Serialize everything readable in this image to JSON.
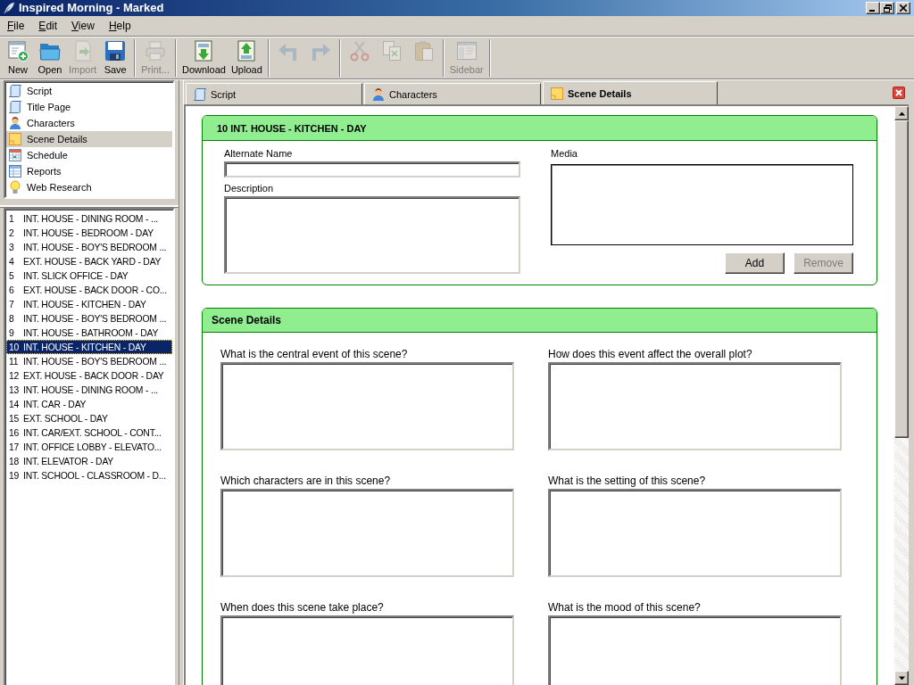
{
  "window": {
    "title": "Inspired Morning - Marked"
  },
  "menu": [
    "File",
    "Edit",
    "View",
    "Help"
  ],
  "toolbar": {
    "groups": [
      [
        {
          "label": "New",
          "disabled": false
        },
        {
          "label": "Open",
          "disabled": false
        },
        {
          "label": "Import",
          "disabled": true
        },
        {
          "label": "Save",
          "disabled": false
        }
      ],
      [
        {
          "label": "Print...",
          "disabled": true
        }
      ],
      [
        {
          "label": "Download",
          "disabled": false
        },
        {
          "label": "Upload",
          "disabled": false
        }
      ],
      [
        {
          "disabled": true
        },
        {
          "disabled": true
        }
      ],
      [
        {
          "disabled": true
        },
        {
          "disabled": true
        },
        {
          "disabled": true
        }
      ],
      [
        {
          "label": "Sidebar",
          "disabled": true
        }
      ]
    ]
  },
  "sidebar": {
    "items": [
      {
        "label": "Script",
        "selected": false
      },
      {
        "label": "Title Page",
        "selected": false
      },
      {
        "label": "Characters",
        "selected": false
      },
      {
        "label": "Scene Details",
        "selected": true
      },
      {
        "label": "Schedule",
        "selected": false
      },
      {
        "label": "Reports",
        "selected": false
      },
      {
        "label": "Web Research",
        "selected": false
      }
    ],
    "scenes": [
      {
        "number": "1",
        "title": "INT. HOUSE - DINING ROOM - ...",
        "selected": false
      },
      {
        "number": "2",
        "title": "INT. HOUSE - BEDROOM - DAY",
        "selected": false
      },
      {
        "number": "3",
        "title": "INT. HOUSE - BOY'S BEDROOM ...",
        "selected": false
      },
      {
        "number": "4",
        "title": "EXT. HOUSE - BACK YARD - DAY",
        "selected": false
      },
      {
        "number": "5",
        "title": "INT. SLICK OFFICE - DAY",
        "selected": false
      },
      {
        "number": "6",
        "title": "EXT. HOUSE - BACK DOOR - CO...",
        "selected": false
      },
      {
        "number": "7",
        "title": "INT. HOUSE - KITCHEN - DAY",
        "selected": false
      },
      {
        "number": "8",
        "title": "INT. HOUSE - BOY'S BEDROOM ...",
        "selected": false
      },
      {
        "number": "9",
        "title": "INT. HOUSE - BATHROOM - DAY",
        "selected": false
      },
      {
        "number": "10",
        "title": "INT. HOUSE - KITCHEN - DAY",
        "selected": true
      },
      {
        "number": "11",
        "title": "INT. HOUSE - BOY'S BEDROOM ...",
        "selected": false
      },
      {
        "number": "12",
        "title": "EXT. HOUSE - BACK DOOR - DAY",
        "selected": false
      },
      {
        "number": "13",
        "title": "INT. HOUSE - DINING ROOM - ...",
        "selected": false
      },
      {
        "number": "14",
        "title": "INT. CAR - DAY",
        "selected": false
      },
      {
        "number": "15",
        "title": "EXT. SCHOOL - DAY",
        "selected": false
      },
      {
        "number": "16",
        "title": "INT. CAR/EXT. SCHOOL - CONT...",
        "selected": false
      },
      {
        "number": "17",
        "title": "INT. OFFICE LOBBY - ELEVATO...",
        "selected": false
      },
      {
        "number": "18",
        "title": "INT. ELEVATOR - DAY",
        "selected": false
      },
      {
        "number": "19",
        "title": "INT. SCHOOL - CLASSROOM - D...",
        "selected": false
      }
    ]
  },
  "tabs": [
    {
      "label": "Script",
      "selected": false
    },
    {
      "label": "Characters",
      "selected": false
    },
    {
      "label": "Scene Details",
      "selected": true
    }
  ],
  "scene_card": {
    "heading": "10 INT. HOUSE - KITCHEN - DAY",
    "alternate_name": {
      "label": "Alternate Name"
    },
    "description": {
      "label": "Description"
    },
    "media": {
      "label": "Media"
    },
    "buttons": [
      {
        "label": "Add",
        "disabled": false
      },
      {
        "label": "Remove",
        "disabled": true
      }
    ]
  },
  "details_card": {
    "heading": "Scene Details",
    "questions": [
      "What is the central event of this scene?",
      "How does this event affect the overall plot?",
      "Which characters are in this scene?",
      "What is the setting of this scene?",
      "When does this scene take place?",
      "What is the mood of this scene?"
    ]
  }
}
